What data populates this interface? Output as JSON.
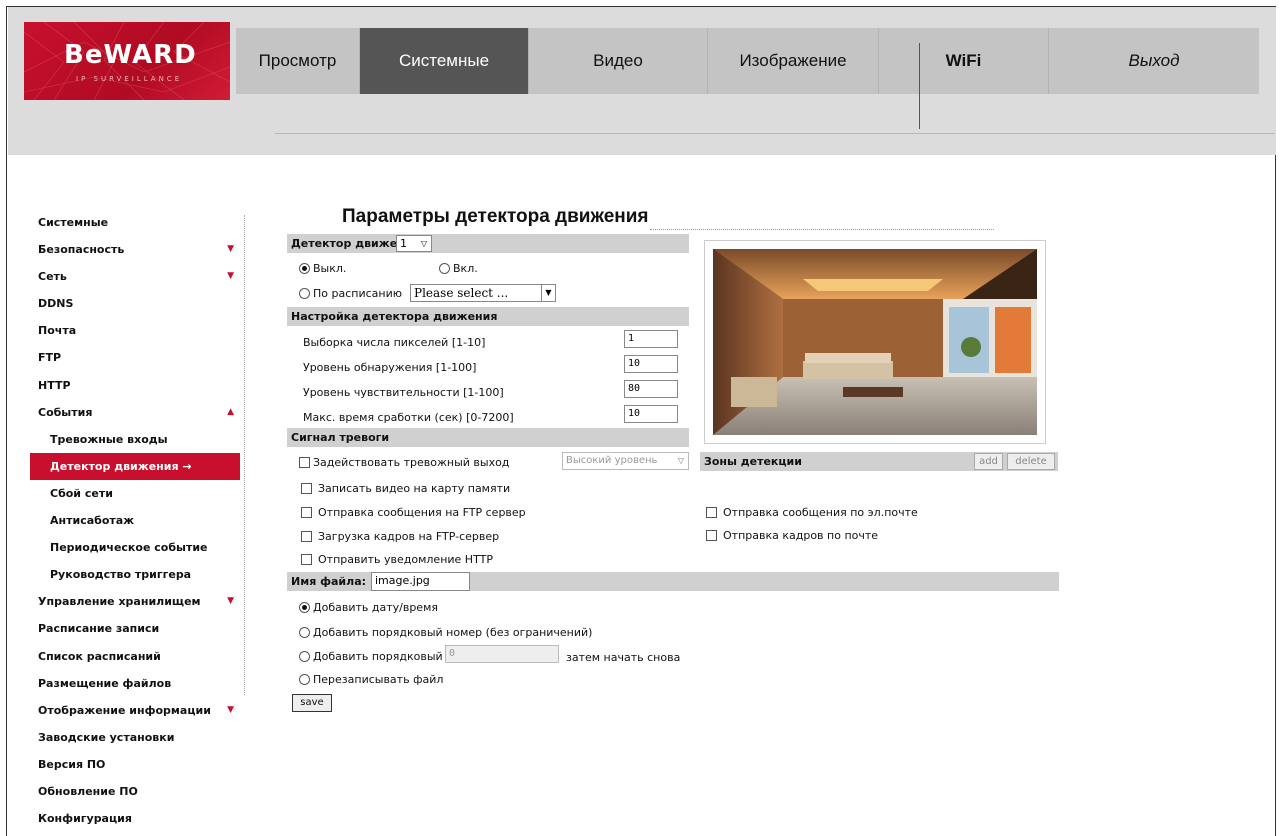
{
  "logo": {
    "text": "BeWARD",
    "sub": "IP SURVEILLANCE"
  },
  "nav": [
    "Просмотр",
    "Системные",
    "Видео",
    "Изображение",
    "WiFi",
    "Выход"
  ],
  "sidebar": [
    {
      "label": "Системные"
    },
    {
      "label": "Безопасность",
      "arrow": "▼"
    },
    {
      "label": "Сеть",
      "arrow": "▼"
    },
    {
      "label": "DDNS"
    },
    {
      "label": "Почта"
    },
    {
      "label": "FTP"
    },
    {
      "label": "HTTP"
    },
    {
      "label": "События",
      "arrow": "▲"
    },
    {
      "label": "Тревожные входы"
    },
    {
      "label": "Детектор движения →"
    },
    {
      "label": "Сбой сети"
    },
    {
      "label": "Антисаботаж"
    },
    {
      "label": "Периодическое событие"
    },
    {
      "label": "Руководство триггера"
    },
    {
      "label": "Управление хранилищем",
      "arrow": "▼"
    },
    {
      "label": "Расписание записи"
    },
    {
      "label": "Список расписаний"
    },
    {
      "label": "Размещение файлов"
    },
    {
      "label": "Отображение информации",
      "arrow": "▼"
    },
    {
      "label": "Заводские установки"
    },
    {
      "label": "Версия ПО"
    },
    {
      "label": "Обновление ПО"
    },
    {
      "label": "Конфигурация"
    }
  ],
  "main": {
    "title": "Параметры детектора движения",
    "detector": {
      "label": "Детектор движения",
      "value": "1",
      "caret": "▽"
    },
    "mode": {
      "off": "Выкл.",
      "on": "Вкл.",
      "schedule": "По расписанию",
      "schedule_select": "Please select ...",
      "schedule_caret": "▼"
    },
    "settings": {
      "title": "Настройка детектора движения",
      "fields": [
        {
          "label": "Выборка числа пикселей [1-10]",
          "value": "1"
        },
        {
          "label": "Уровень обнаружения [1-100]",
          "value": "10"
        },
        {
          "label": "Уровень чувствительности [1-100]",
          "value": "80"
        },
        {
          "label": "Макс. время сработки (сек) [0-7200]",
          "value": "10"
        }
      ]
    },
    "alarm": {
      "title": "Сигнал тревоги",
      "use_output": "Задействовать тревожный выход",
      "level_select": "Высокий уровень",
      "level_caret": "▽",
      "record_card": "Записать видео на карту памяти",
      "ftp_msg": "Отправка сообщения на FTP сервер",
      "ftp_upload": "Загрузка кадров на FTP-сервер",
      "http_notify": "Отправить уведомление HTTP",
      "email_msg": "Отправка сообщения по эл.почте",
      "email_frames": "Отправка кадров по почте"
    },
    "zones": {
      "title": "Зоны детекции",
      "add": "add",
      "delete": "delete"
    },
    "filename": {
      "label": "Имя файла:",
      "value": "image.jpg",
      "opt1": "Добавить дату/время",
      "opt2": "Добавить порядковый номер (без ограничений)",
      "opt3": "Добавить порядковый номер до",
      "opt3_value": "0",
      "opt3_suffix": "затем начать снова",
      "opt4": "Перезаписывать файл"
    },
    "save": "save"
  }
}
